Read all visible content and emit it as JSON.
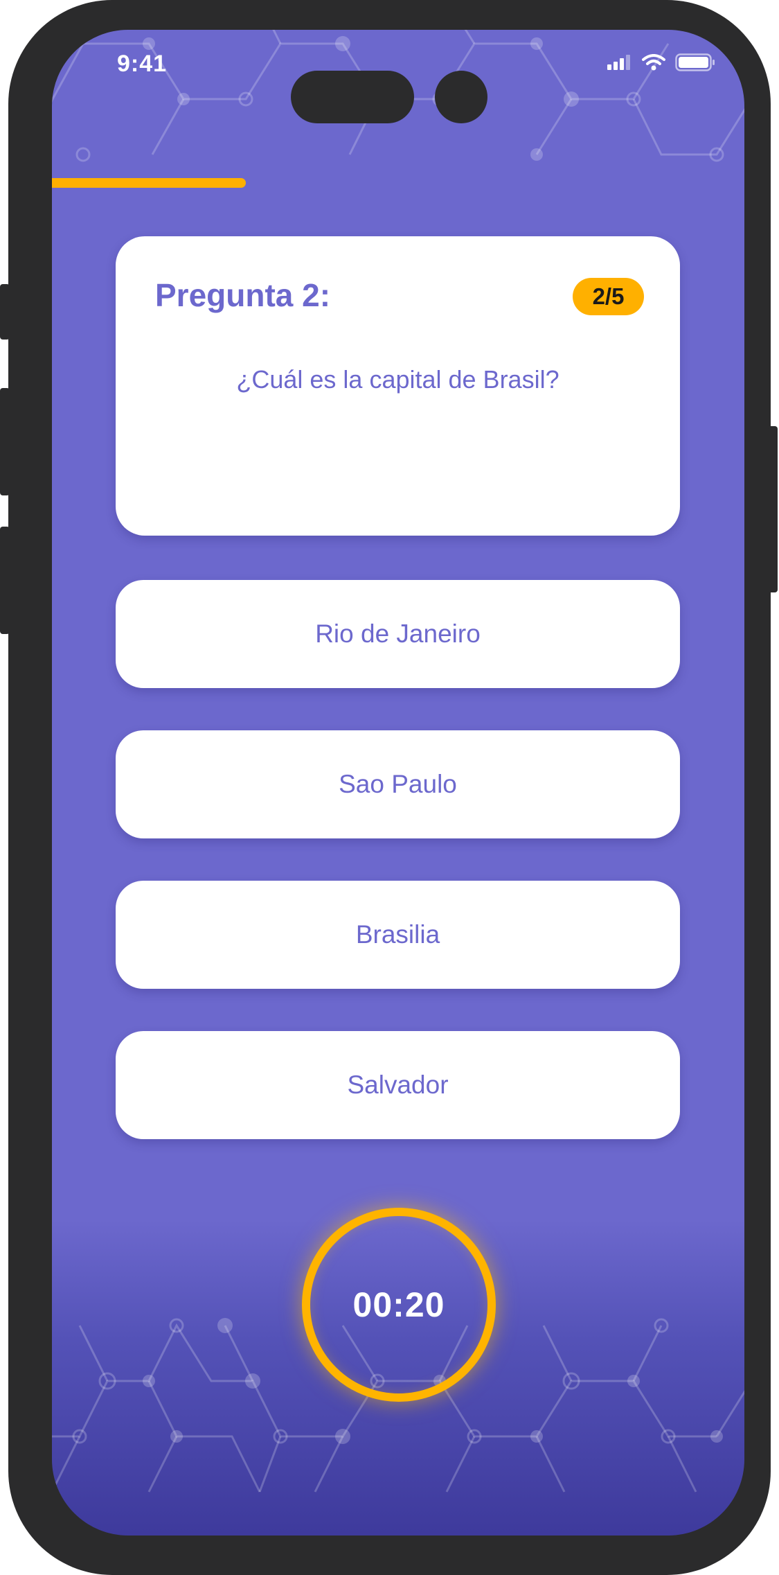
{
  "status_bar": {
    "time": "9:41",
    "icons": [
      "cellular-signal-icon",
      "wifi-icon",
      "battery-icon"
    ]
  },
  "progress": {
    "value": 0.28
  },
  "question": {
    "title": "Pregunta 2:",
    "counter": "2/5",
    "text": "¿Cuál es la capital de Brasil?"
  },
  "answers": [
    {
      "label": "Rio de Janeiro"
    },
    {
      "label": "Sao Paulo"
    },
    {
      "label": "Brasilia"
    },
    {
      "label": "Salvador"
    }
  ],
  "timer": {
    "label": "00:20"
  },
  "colors": {
    "background": "#6c68cd",
    "background_bottom": "#3e3a9c",
    "accent": "#ffb000",
    "card": "#ffffff",
    "text": "#6c68cd",
    "frame": "#2b2b2c"
  }
}
